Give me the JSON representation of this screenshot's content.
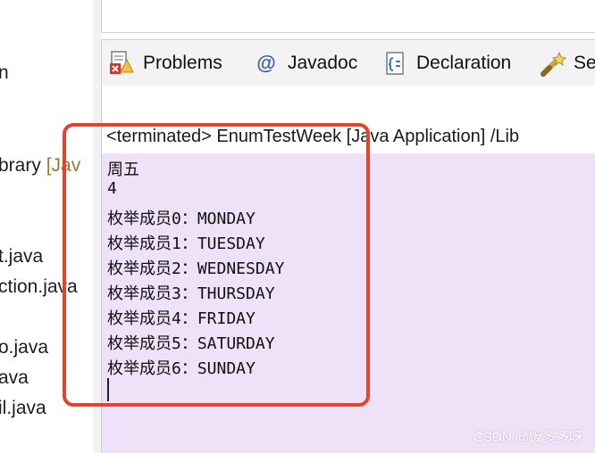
{
  "explorer": {
    "items": [
      {
        "text": "n"
      },
      {
        "text": "brary ",
        "lib": "[Jav"
      },
      {
        "text": "t.java"
      },
      {
        "text": "ction.java"
      },
      {
        "text": "o.java"
      },
      {
        "text": "ava"
      },
      {
        "text": "il.java"
      }
    ]
  },
  "tabs": [
    {
      "label": "Problems",
      "icon": "problems-icon"
    },
    {
      "label": "Javadoc",
      "icon": "at-icon",
      "glyph": "@"
    },
    {
      "label": "Declaration",
      "icon": "declaration-icon"
    },
    {
      "label": "Se",
      "icon": "search-wand-icon"
    }
  ],
  "console": {
    "title": "<terminated> EnumTestWeek [Java Application] /Lib",
    "lines": [
      "周五",
      "4",
      "枚举成员0：MONDAY",
      "枚举成员1：TUESDAY",
      "枚举成员2：WEDNESDAY",
      "枚举成员3：THURSDAY",
      "枚举成员4：FRIDAY",
      "枚举成员5：SATURDAY",
      "枚举成员6：SUNDAY"
    ]
  },
  "watermark": "CSDN @饭多多呀",
  "colors": {
    "console_bg": "#efe1f7",
    "highlight": "#e5432e",
    "library_text": "#9a7a2e"
  }
}
